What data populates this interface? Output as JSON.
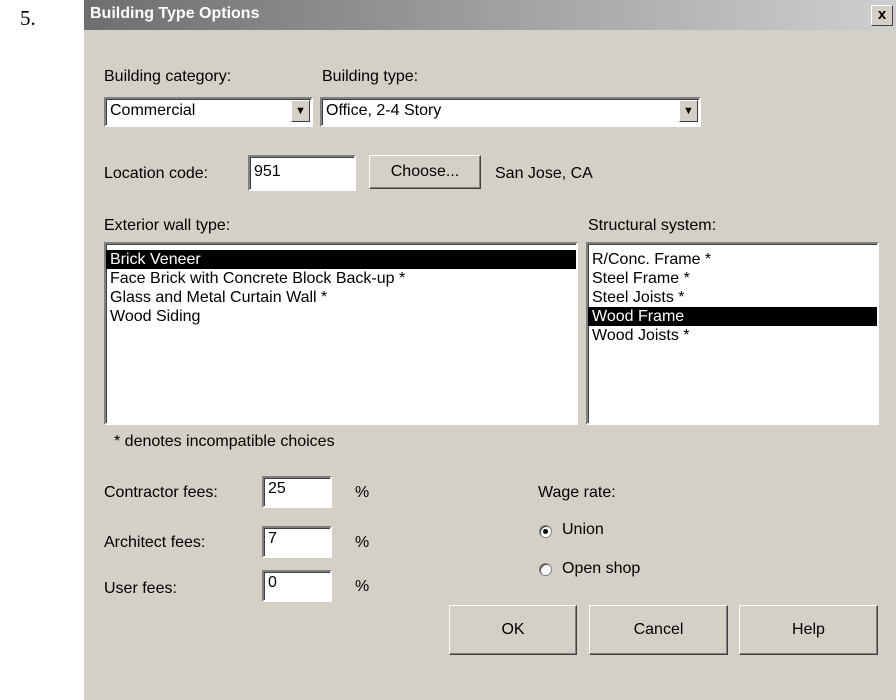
{
  "step_label": "5.",
  "window": {
    "title": "Building Type Options",
    "close_glyph": "x"
  },
  "building_category": {
    "label": "Building category:",
    "value": "Commercial"
  },
  "building_type": {
    "label": "Building type:",
    "value": "Office, 2-4 Story"
  },
  "location": {
    "label": "Location code:",
    "value": "951",
    "choose_label": "Choose...",
    "city": "San Jose, CA"
  },
  "exterior_wall": {
    "label": "Exterior wall type:",
    "items": [
      "Brick Veneer",
      "Face Brick with Concrete Block Back-up *",
      "Glass and Metal Curtain Wall *",
      "Wood Siding"
    ],
    "selected": 0
  },
  "structural": {
    "label": "Structural system:",
    "items": [
      "R/Conc. Frame *",
      "Steel Frame *",
      "Steel Joists *",
      "Wood Frame",
      "Wood Joists *"
    ],
    "selected": 3
  },
  "note": "* denotes incompatible choices",
  "fees": [
    {
      "label": "Contractor fees:",
      "value": "25",
      "unit": "%"
    },
    {
      "label": "Architect fees:",
      "value": "7",
      "unit": "%"
    },
    {
      "label": "User fees:",
      "value": "0",
      "unit": "%"
    }
  ],
  "wage": {
    "label": "Wage rate:",
    "options": [
      "Union",
      "Open shop"
    ],
    "selected": "Union"
  },
  "buttons": {
    "ok": "OK",
    "cancel": "Cancel",
    "help": "Help"
  }
}
